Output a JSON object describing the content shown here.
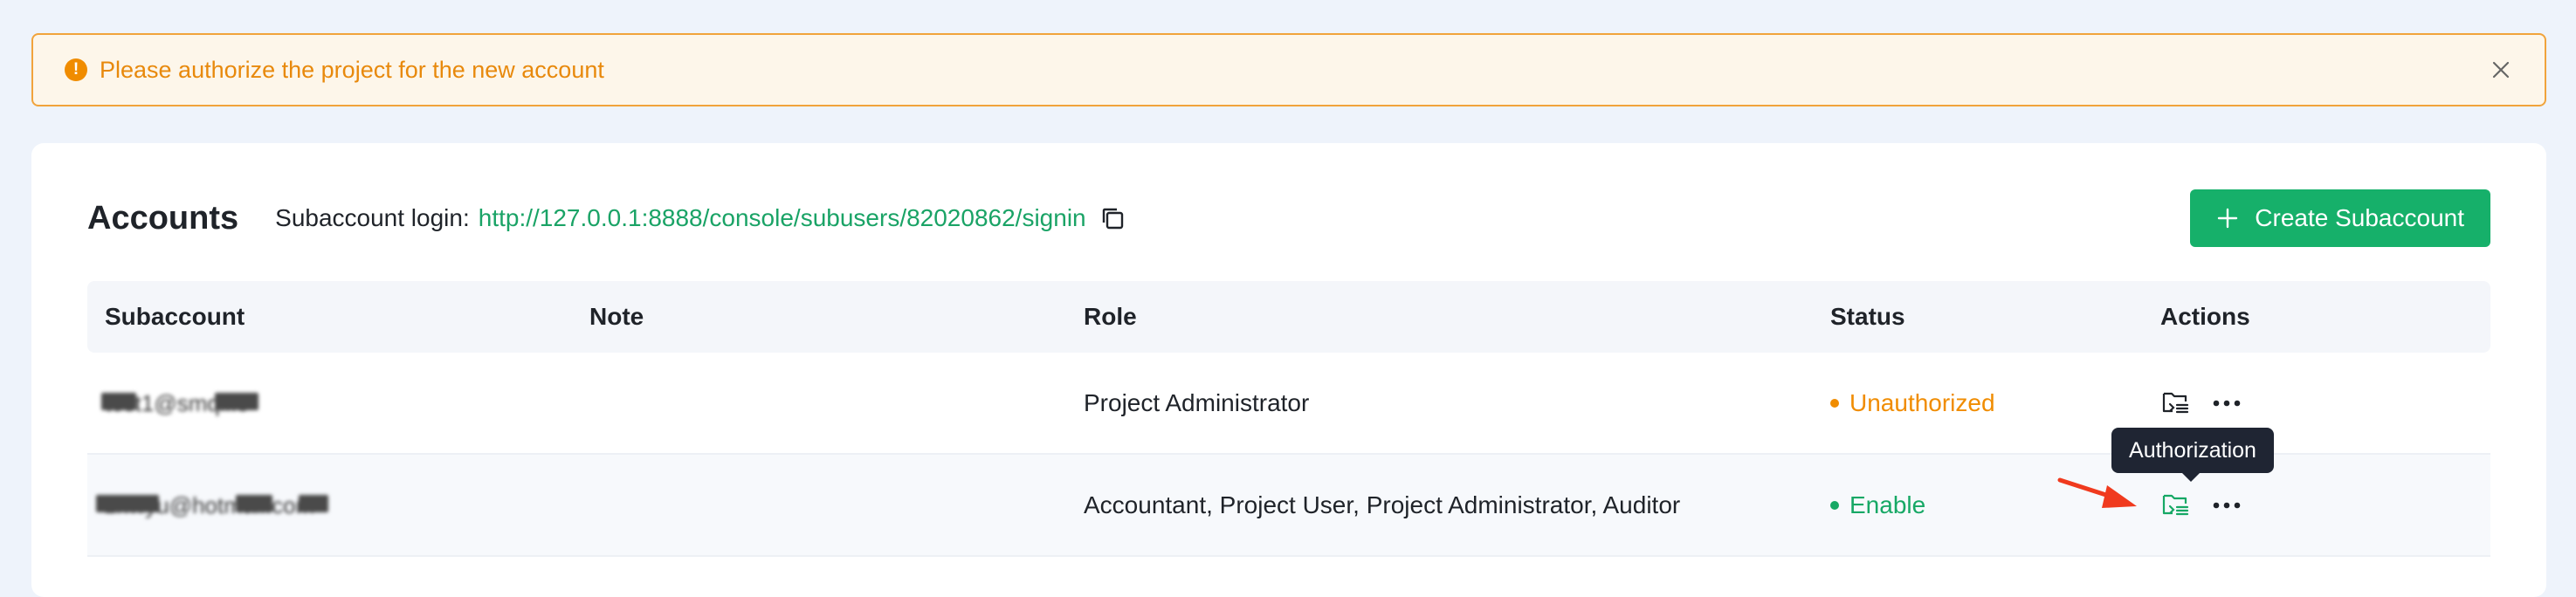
{
  "alert": {
    "message": "Please authorize the project for the new account",
    "icon": "warning-circle-icon",
    "close_icon": "close-icon"
  },
  "header": {
    "title": "Accounts",
    "login_label": "Subaccount login:",
    "login_url": "http://127.0.0.1:8888/console/subusers/82020862/signin",
    "create_button": "Create Subaccount"
  },
  "table": {
    "columns": [
      "Subaccount",
      "Note",
      "Role",
      "Status",
      "Actions"
    ],
    "rows": [
      {
        "subaccount": "test1@smqlfle",
        "note": "",
        "role": "Project Administrator",
        "status": "Unauthorized"
      },
      {
        "subaccount": "zhwyu@hotmail.com",
        "note": "",
        "role": "Accountant, Project User, Project Administrator, Auditor",
        "status": "Enable"
      }
    ]
  },
  "tooltip": {
    "text": "Authorization"
  },
  "colors": {
    "accent": "#16b06a",
    "warning": "#f08c00",
    "link": "#1aa366"
  }
}
